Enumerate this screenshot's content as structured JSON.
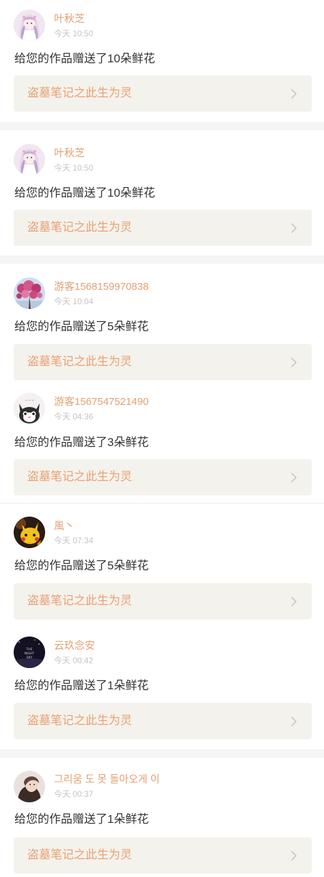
{
  "notifications": [
    {
      "user": "叶秋芝",
      "time": "今天 10:50",
      "message": "给您的作品赠送了10朵鲜花",
      "work_title": "盗墓笔记之此生为灵",
      "avatar_icon": "anime-girl-avatar"
    },
    {
      "user": "叶秋芝",
      "time": "今天 10:50",
      "message": "给您的作品赠送了10朵鲜花",
      "work_title": "盗墓笔记之此生为灵",
      "avatar_icon": "anime-girl-avatar"
    },
    {
      "user": "游客1568159970838",
      "time": "今天 10:04",
      "message": "给您的作品赠送了5朵鲜花",
      "work_title": "盗墓笔记之此生为灵",
      "avatar_icon": "blossom-tree-avatar"
    },
    {
      "user": "游客1567547521490",
      "time": "今天 04:36",
      "message": "给您的作品赠送了3朵鲜花",
      "work_title": "盗墓笔记之此生为灵",
      "avatar_icon": "cartoon-cat-avatar"
    },
    {
      "user": "風丶",
      "time": "今天 07:34",
      "message": "给您的作品赠送了5朵鲜花",
      "work_title": "盗墓笔记之此生为灵",
      "avatar_icon": "pikachu-avatar"
    },
    {
      "user": "云玖念安",
      "time": "今天 00:42",
      "message": "给您的作品赠送了1朵鲜花",
      "work_title": "盗墓笔记之此生为灵",
      "avatar_icon": "night-sky-avatar"
    },
    {
      "user": "그리움 도 못 돌아오게 이",
      "time": "今天 00:37",
      "message": "给您的作品赠送了1朵鲜花",
      "work_title": "盗墓笔记之此生为灵",
      "avatar_icon": "portrait-avatar"
    }
  ],
  "colors": {
    "name": "#e0a072",
    "time": "#c4c4c4",
    "message": "#333333",
    "work_bg": "#f4f2ec",
    "work_title": "#e8a173",
    "separator": "#f6f4f4"
  },
  "icons": {
    "chevron": "chevron-right-icon"
  }
}
